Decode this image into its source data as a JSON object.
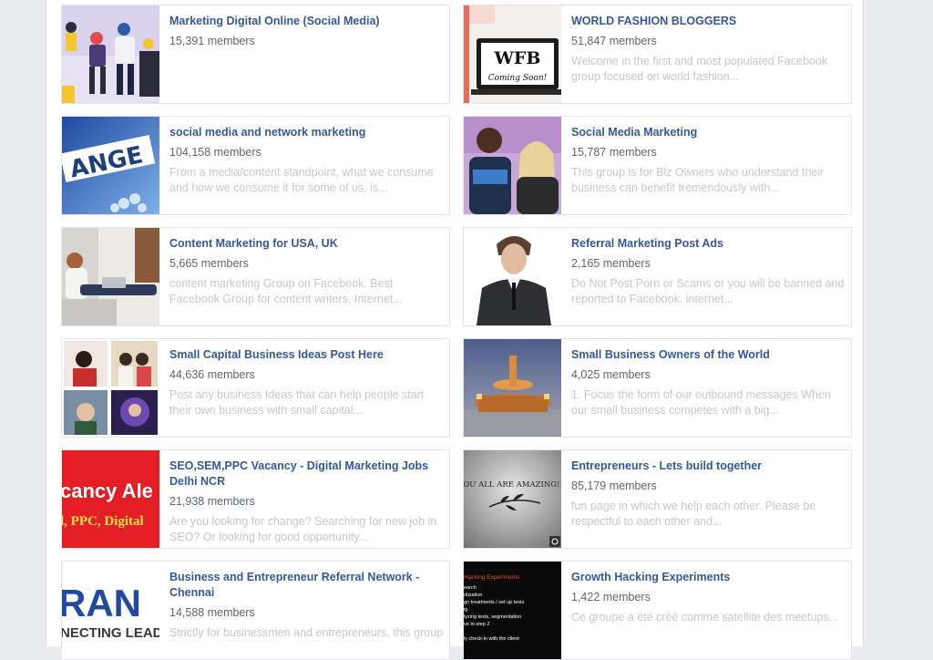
{
  "groups": [
    {
      "title": "Marketing Digital Online (Social Media)",
      "members": "15,391 members",
      "description": "",
      "thumb_icon": "people-illustration-icon"
    },
    {
      "title": "WORLD FASHION BLOGGERS",
      "members": "51,847 members",
      "description": "Welcome in the first and most populated Facebook group focused on world fashion...",
      "thumb_icon": "laptop-logo-icon",
      "thumb_text": "WFB",
      "thumb_subtext": "Coming Soon!"
    },
    {
      "title": "social media and network marketing",
      "members": "104,158 members",
      "description": "From a media/content standpoint, what we consume and how we consume it for some of us, is...",
      "thumb_icon": "change-blocks-icon",
      "thumb_text": "ANGE"
    },
    {
      "title": "Social Media Marketing",
      "members": "15,787 members",
      "description": "This group is for Biz Owners who understand their business can benefit tremendously with...",
      "thumb_icon": "couple-photo-icon"
    },
    {
      "title": "Content Marketing for USA, UK",
      "members": "5,665 members",
      "description": "content marketing Group on Facebook. Best Facebook Group for content writers, Internet...",
      "thumb_icon": "woman-laptop-photo-icon"
    },
    {
      "title": "Referral Marketing Post Ads",
      "members": "2,165 members",
      "description": "Do Not Post Porn or Scams or you will be banned and reported to Facebook. internet...",
      "thumb_icon": "man-suit-photo-icon"
    },
    {
      "title": "Small Capital Business Ideas Post Here",
      "members": "44,636 members",
      "description": "Post any business Ideas that can help people start their own business with small capital...",
      "thumb_icon": "photo-collage-icon"
    },
    {
      "title": "Small Business Owners of the World",
      "members": "4,025 members",
      "description": "1. Focus the form of our outbound messages When our small business competes with a big...",
      "thumb_icon": "fountain-photo-icon"
    },
    {
      "title": "SEO,SEM,PPC Vacancy - Digital Marketing Jobs Delhi NCR",
      "members": "21,938 members",
      "description": "Are you looking for change? Searching for new job in SEO? Or looking for good opportunity...",
      "thumb_icon": "vacancy-banner-icon",
      "thumb_text": "cancy Ale",
      "thumb_subtext": "l, PPC, Digital"
    },
    {
      "title": "Entrepreneurs - Lets build together",
      "members": "85,179 members",
      "description": "fun page in which we help each other. Please be respectful to each other and...",
      "thumb_icon": "amazing-quote-icon",
      "thumb_text": "YOU ALL ARE AMAZING!!!"
    },
    {
      "title": "Business and Entrepreneur Referral Network - Chennai",
      "members": "14,588 members",
      "description": "Strictly for businessmen and entrepreneurs, this group",
      "thumb_icon": "brand-logo-icon",
      "thumb_text": "RAN",
      "thumb_subtext": "NECTING LEAD"
    },
    {
      "title": "Growth Hacking Experiments",
      "members": "1,422 members",
      "description": "Ce groupe à été créé comme satellite des meetups...",
      "thumb_icon": "experiment-list-icon",
      "thumb_text": "Hacking Experiments",
      "thumb_lines": [
        "earch",
        "ritization",
        "gn treatments / set up tests",
        "ig",
        "lyzing tests, segmentation",
        "ve to step 2",
        "",
        "ly check-in with the client"
      ]
    }
  ],
  "colors": {
    "title": "#365899",
    "members": "#606770",
    "description": "#c5c8cd"
  }
}
